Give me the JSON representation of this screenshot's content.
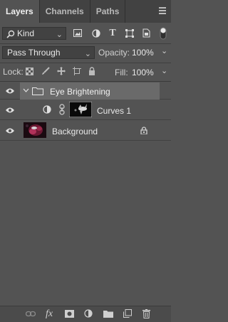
{
  "tabs": [
    {
      "label": "Layers",
      "active": true
    },
    {
      "label": "Channels",
      "active": false
    },
    {
      "label": "Paths",
      "active": false
    }
  ],
  "filter": {
    "label": "Kind",
    "icons": [
      "image-filter-icon",
      "adjustment-filter-icon",
      "type-filter-icon",
      "shape-filter-icon",
      "smart-object-filter-icon",
      "filter-toggle-icon"
    ]
  },
  "blend": {
    "mode": "Pass Through",
    "opacity_label": "Opacity:",
    "opacity_value": "100%"
  },
  "lock": {
    "label": "Lock:",
    "fill_label": "Fill:",
    "fill_value": "100%"
  },
  "layers": [
    {
      "name": "Eye Brightening",
      "type": "group",
      "selected": true
    },
    {
      "name": "Curves 1",
      "type": "adjustment"
    },
    {
      "name": "Background",
      "type": "pixel",
      "locked": true
    }
  ],
  "colors": {
    "panel": "#535353",
    "selected": "#6a6a6a",
    "tabbar": "#424242"
  }
}
